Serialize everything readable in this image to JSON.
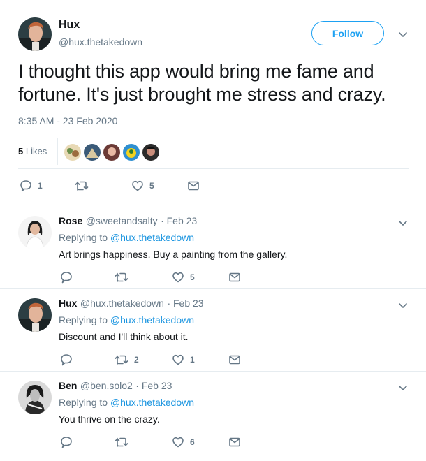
{
  "main_tweet": {
    "author": {
      "name": "Hux",
      "handle": "@hux.thetakedown"
    },
    "follow_label": "Follow",
    "text": "I thought this app would bring me fame and fortune. It's just brought me stress and crazy.",
    "timestamp": "8:35 AM - 23 Feb 2020",
    "likes_count": "5",
    "likes_word": "Likes",
    "liked_by_avatars": [
      "avatar-1",
      "avatar-2",
      "avatar-3",
      "avatar-4",
      "avatar-5"
    ],
    "actions": {
      "replies": "1",
      "retweets": "",
      "likes": "5"
    }
  },
  "replies": [
    {
      "name": "Rose",
      "handle": "@sweetandsalty",
      "date": "· Feb 23",
      "replying_prefix": "Replying to",
      "replying_to": "@hux.thetakedown",
      "text": "Art brings happiness. Buy a painting from the gallery.",
      "actions": {
        "replies": "",
        "retweets": "",
        "likes": "5"
      }
    },
    {
      "name": "Hux",
      "handle": "@hux.thetakedown",
      "date": "· Feb 23",
      "replying_prefix": "Replying to",
      "replying_to": "@hux.thetakedown",
      "text": "Discount and I'll think about it.",
      "actions": {
        "replies": "",
        "retweets": "2",
        "likes": "1"
      }
    },
    {
      "name": "Ben",
      "handle": "@ben.solo2",
      "date": "· Feb 23",
      "replying_prefix": "Replying to",
      "replying_to": "@hux.thetakedown",
      "text": "You thrive on the crazy.",
      "actions": {
        "replies": "",
        "retweets": "",
        "likes": "6"
      }
    }
  ],
  "icons": {
    "reply": "reply-icon",
    "retweet": "retweet-icon",
    "like": "heart-icon",
    "dm": "envelope-icon",
    "more": "chevron-down-icon"
  },
  "colors": {
    "accent": "#1da1f2",
    "link": "#1b95e0",
    "muted": "#657786",
    "divider": "#e6ecf0"
  }
}
